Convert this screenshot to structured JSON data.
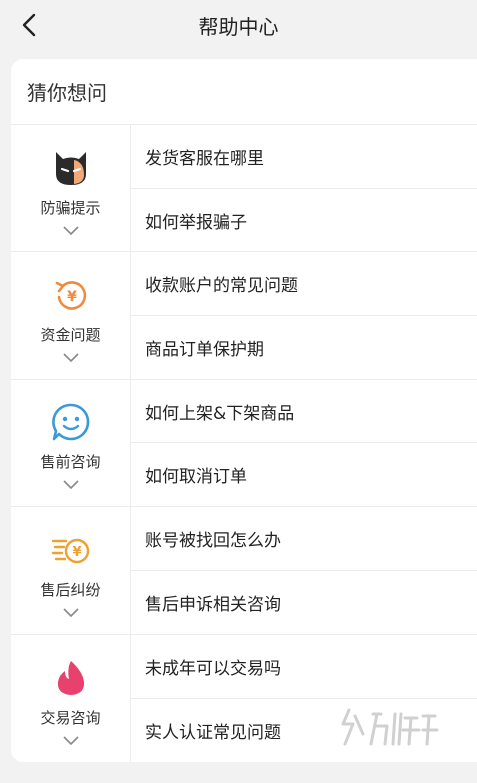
{
  "header": {
    "title": "帮助中心"
  },
  "card": {
    "heading": "猜你想问"
  },
  "groups": [
    {
      "label": "防骗提示",
      "icon": "devil-face-icon",
      "questions": [
        "发货客服在哪里",
        "如何举报骗子"
      ]
    },
    {
      "label": "资金问题",
      "icon": "refund-yen-icon",
      "questions": [
        "收款账户的常见问题",
        "商品订单保护期"
      ]
    },
    {
      "label": "售前咨询",
      "icon": "chat-smile-icon",
      "questions": [
        "如何上架&下架商品",
        "如何取消订单"
      ]
    },
    {
      "label": "售后纠纷",
      "icon": "fast-yen-icon",
      "questions": [
        "账号被找回怎么办",
        "售后申诉相关咨询"
      ]
    },
    {
      "label": "交易咨询",
      "icon": "flame-icon",
      "questions": [
        "未成年可以交易吗",
        "实人认证常见问题"
      ]
    }
  ],
  "colors": {
    "orange": "#f08a3c",
    "blue": "#3a9ad9",
    "pink": "#e8416e",
    "dark": "#2b2b2b"
  }
}
